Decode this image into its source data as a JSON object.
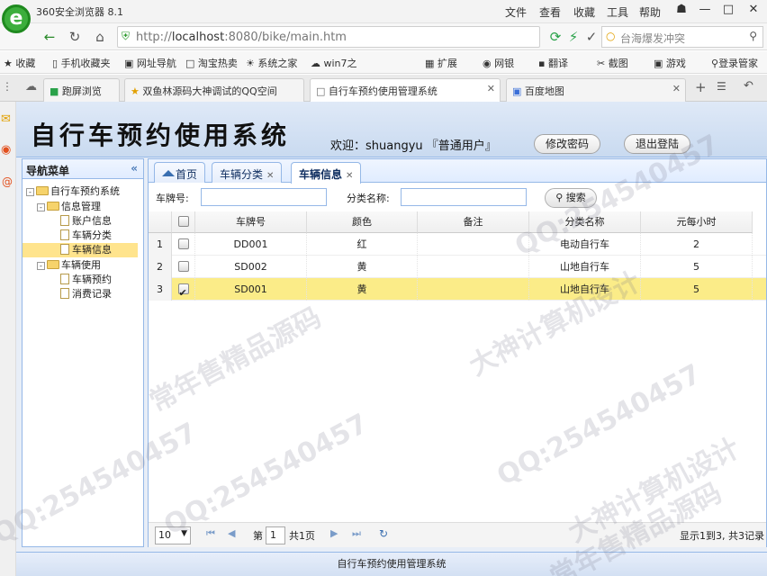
{
  "browser": {
    "title": "360安全浏览器 8.1",
    "menu": [
      "文件",
      "查看",
      "收藏",
      "工具",
      "帮助"
    ],
    "url_prefix": "http://",
    "url_host": "localhost",
    "url_rest": ":8080/bike/main.htm",
    "search_placeholder": "台海爆发冲突",
    "bookmarks": [
      "收藏",
      "手机收藏夹",
      "网址导航",
      "淘宝热卖",
      "系统之家",
      "win7之",
      "扩展",
      "网银",
      "翻译",
      "截图",
      "游戏",
      "登录管家"
    ],
    "tabs": [
      {
        "label": "跑屏浏览"
      },
      {
        "label": "双鱼林源码大神调试的QQ空间"
      },
      {
        "label": "自行车预约使用管理系统"
      },
      {
        "label": "百度地图"
      }
    ]
  },
  "app": {
    "title": "自行车预约使用系统",
    "welcome": "欢迎：shuangyu 『普通用户』",
    "change_password": "修改密码",
    "logout": "退出登陆",
    "footer": "自行车预约使用管理系统"
  },
  "nav": {
    "header": "导航菜单",
    "collapse": "«",
    "root": "自行车预约系统",
    "groups": [
      {
        "label": "信息管理",
        "items": [
          "账户信息",
          "车辆分类",
          "车辆信息"
        ]
      },
      {
        "label": "车辆使用",
        "items": [
          "车辆预约",
          "消费记录"
        ]
      }
    ]
  },
  "tabs": [
    {
      "label": "首页"
    },
    {
      "label": "车辆分类"
    },
    {
      "label": "车辆信息"
    }
  ],
  "search": {
    "plate_label": "车牌号:",
    "plate_value": "",
    "category_label": "分类名称:",
    "category_value": "",
    "button": "搜索"
  },
  "grid": {
    "columns": [
      "车牌号",
      "颜色",
      "备注",
      "分类名称",
      "元每小时"
    ],
    "rows": [
      {
        "num": "1",
        "plate": "DD001",
        "color": "红",
        "note": "",
        "category": "电动自行车",
        "price": "2",
        "checked": false
      },
      {
        "num": "2",
        "plate": "SD002",
        "color": "黄",
        "note": "",
        "category": "山地自行车",
        "price": "5",
        "checked": false
      },
      {
        "num": "3",
        "plate": "SD001",
        "color": "黄",
        "note": "",
        "category": "山地自行车",
        "price": "5",
        "checked": true
      }
    ]
  },
  "pager": {
    "page_size": "10",
    "page_prefix": "第",
    "page_num": "1",
    "page_suffix": "共1页",
    "summary": "显示1到3, 共3记录"
  },
  "watermarks": [
    "常年售精品源码",
    "QQ:254540457",
    "大神计算机设计",
    "常年售精品源码",
    "QQ:254540457",
    "大神计算机设计",
    "QQ:254540457",
    "QQ:254540457"
  ],
  "colors": {
    "accent": "#95b8e7",
    "selected_row": "#fbec88",
    "tree_selected": "#ffe48d"
  }
}
